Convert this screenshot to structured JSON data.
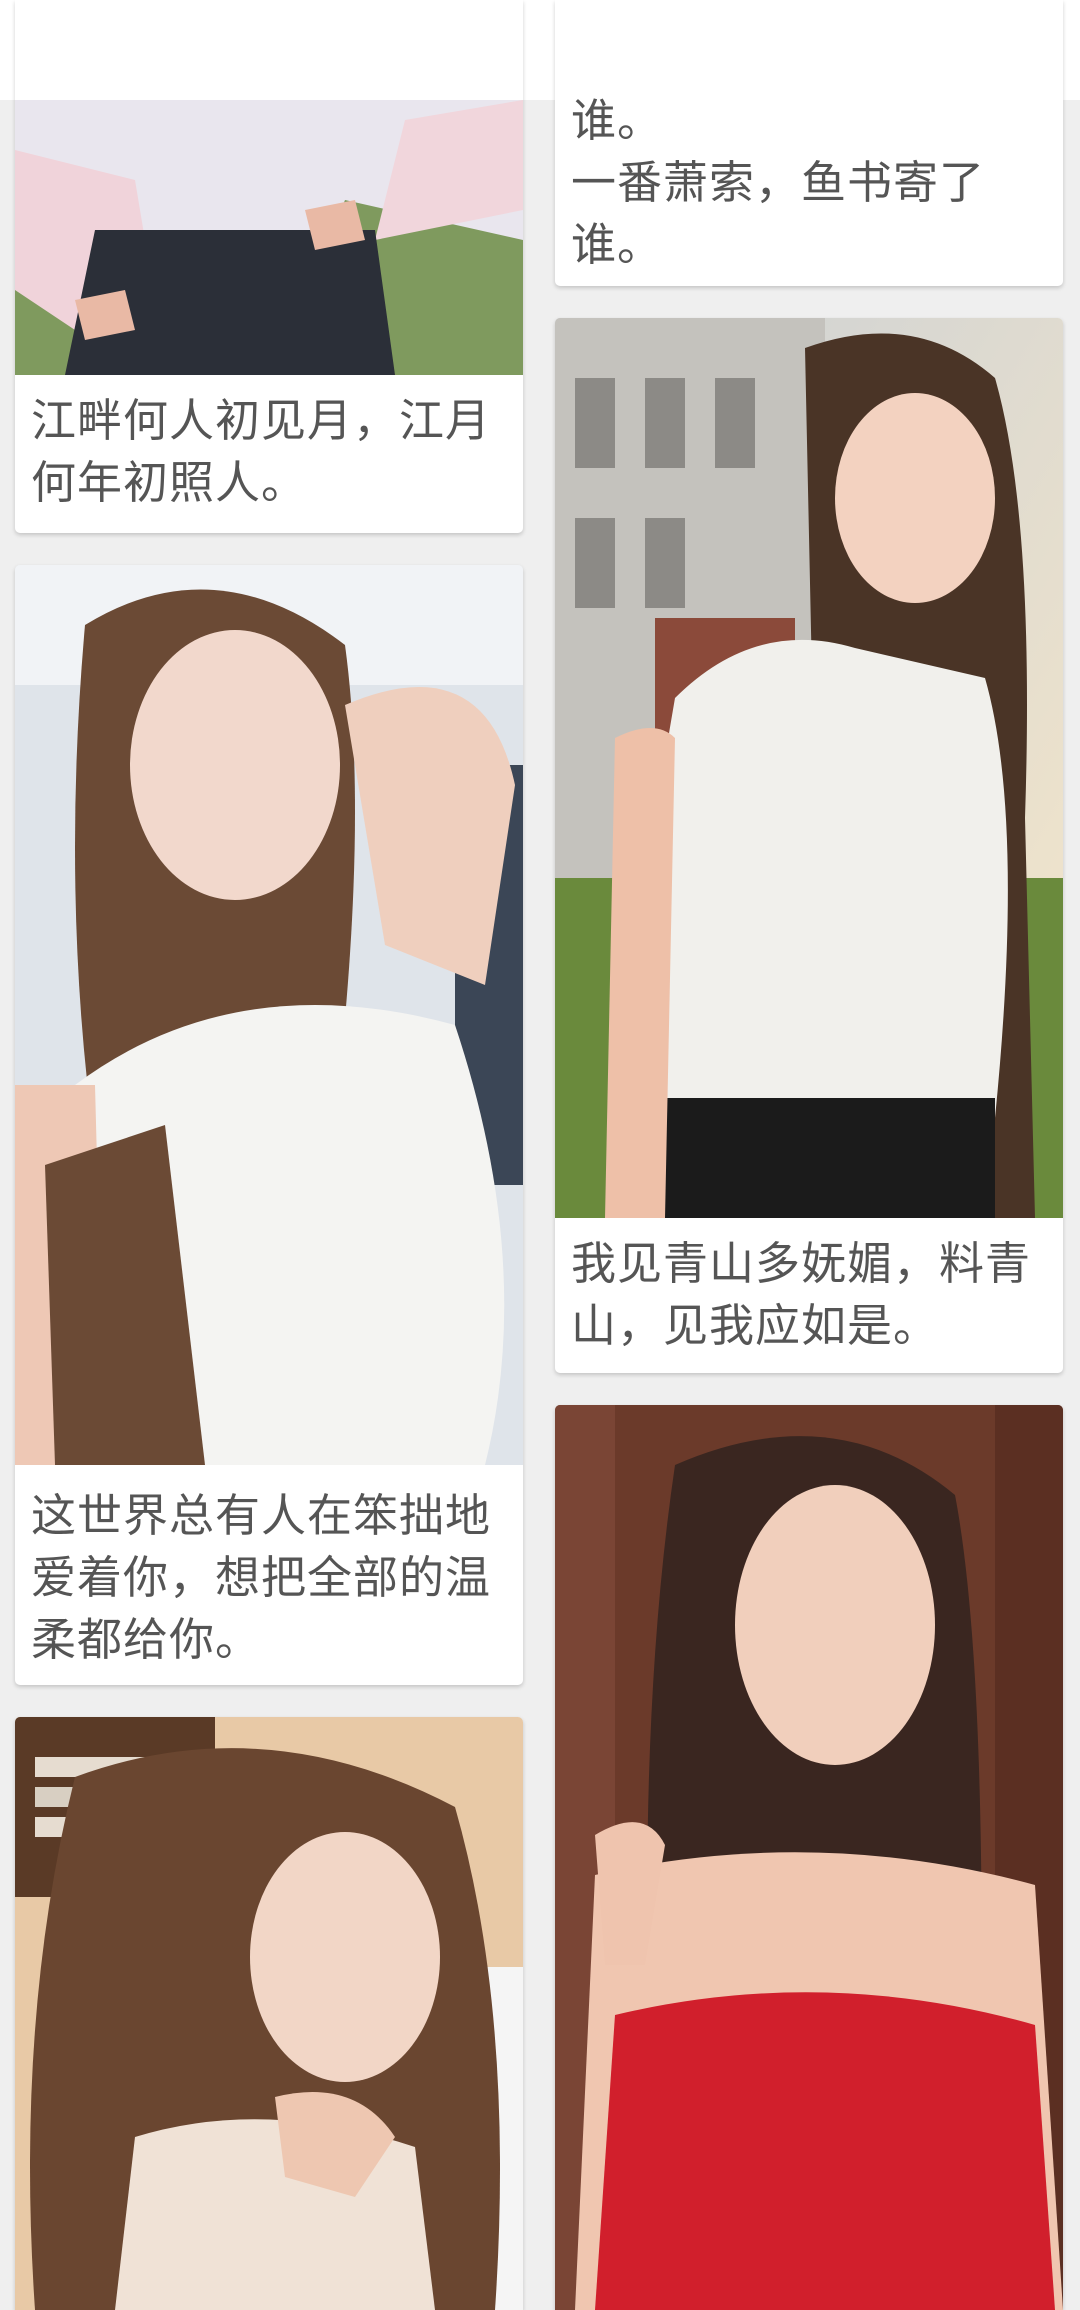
{
  "feed": {
    "card_1": {
      "photo_icon": "photo-image"
    },
    "card_2": {
      "line1": "谁。",
      "line2": "一番萧索，鱼书寄了",
      "line3": "谁。"
    },
    "card_3": {
      "photo_icon": "photo-image",
      "line1": "江畔何人初见月，江月",
      "line2": "何年初照人。"
    },
    "card_4": {
      "photo_icon": "photo-image",
      "line1": "我见青山多妩媚，料青",
      "line2": "山，见我应如是。"
    },
    "card_5": {
      "photo_icon": "photo-image",
      "line1": "这世界总有人在笨拙地",
      "line2": "爱着你，想把全部的温",
      "line3": "柔都给你。"
    },
    "card_6": {
      "photo_icon": "photo-image"
    },
    "card_7": {
      "photo_icon": "photo-image"
    }
  },
  "colors": {
    "background": "#efefef",
    "card": "#ffffff",
    "caption_text": "#555555"
  }
}
